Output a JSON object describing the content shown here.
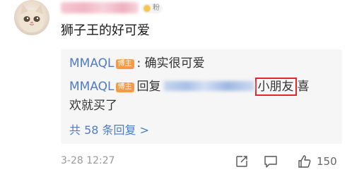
{
  "comment": {
    "text": "狮子王的好可爱",
    "fan_badge": "粉"
  },
  "replies": [
    {
      "author": "MMAQL",
      "badge": "博主",
      "text": ": 确实很可爱"
    },
    {
      "author": "MMAQL",
      "badge": "博主",
      "reply_word": "回复",
      "highlight": "小朋友",
      "text_after": "喜",
      "text_line2": "欢就买了"
    }
  ],
  "more_replies": "共 58 条回复 >",
  "footer": {
    "timestamp": "3-28 12:27",
    "like_count": "150"
  },
  "icons": {
    "share": "share-icon",
    "comment": "comment-icon",
    "like": "thumbs-up-icon"
  },
  "colors": {
    "link_blue": "#4f7cc4",
    "badge_orange": "#f79a45",
    "highlight_red": "#e4262b"
  }
}
